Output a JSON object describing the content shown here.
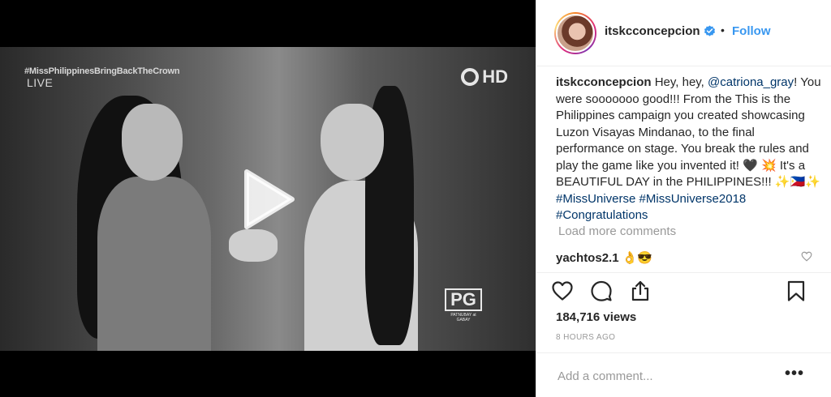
{
  "video": {
    "overlay_hashtag": "#MissPhilippinesBringBackTheCrown",
    "overlay_live": "LIVE",
    "overlay_hd": "HD",
    "overlay_rating": "PG",
    "overlay_rating_sub": "PATNUBAY at GABAY"
  },
  "header": {
    "username": "itskcconcepcion",
    "separator": "•",
    "follow_label": "Follow"
  },
  "caption": {
    "author": "itskcconcepcion",
    "part1": "Hey, hey,",
    "mention": "@catriona_gray",
    "part2": "! You were sooooooo good!!! From the This is the Philippines campaign you created showcasing Luzon Visayas Mindanao, to the final performance on stage. You break the rules and play the game like you invented it! 🖤 💥  It's a BEAUTIFUL DAY in the PHILIPPINES!!! ✨🇵🇭✨",
    "tag1": "#MissUniverse",
    "tag2": "#MissUniverse2018",
    "tag3": "#Congratulations"
  },
  "load_more_label": "Load more comments",
  "comments": [
    {
      "user": "yachtos2.1",
      "text": "👌😎"
    }
  ],
  "stats": {
    "views": "184,716 views",
    "time": "8 HOURS AGO"
  },
  "add_comment": {
    "placeholder": "Add a comment...",
    "more": "•••"
  },
  "colors": {
    "accent": "#3897f0",
    "link": "#003569",
    "muted": "#999999",
    "border": "#efefef"
  }
}
